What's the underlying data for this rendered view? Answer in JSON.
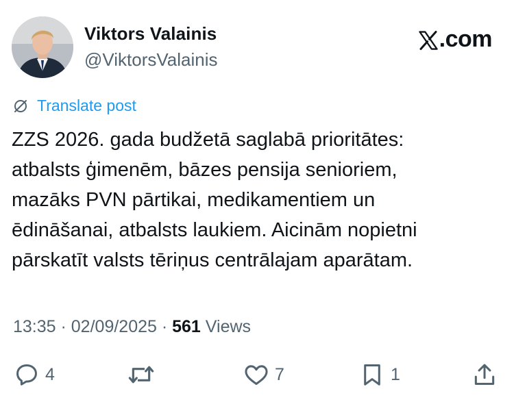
{
  "author": {
    "name": "Viktors Valainis",
    "handle": "@ViktorsValainis"
  },
  "brand": {
    "label": ".com"
  },
  "translate": {
    "label": "Translate post"
  },
  "tweet": {
    "text": "ZZS 2026. gada budžetā saglabā prioritātes:\natbalsts ģimenēm, bāzes pensija senioriem,\nmazāks PVN pārtikai, medikamentiem un\nēdināšanai, atbalsts laukiem. Aicinām nopietni\npārskatīt valsts tēriņus centrālajam aparātam."
  },
  "meta": {
    "time": "13:35",
    "separator": " · ",
    "date": "02/09/2025",
    "views_count": "561",
    "views_label": " Views"
  },
  "actions": {
    "replies": "4",
    "likes": "7",
    "bookmarks": "1"
  },
  "colors": {
    "accent": "#1d9bf0",
    "text": "#0f1419",
    "secondary": "#536471"
  },
  "icons": {
    "translate": "translate-icon",
    "reply": "reply-icon",
    "repost": "repost-icon",
    "like": "heart-icon",
    "bookmark": "bookmark-icon",
    "share": "share-icon",
    "brand": "x-logo-icon"
  }
}
